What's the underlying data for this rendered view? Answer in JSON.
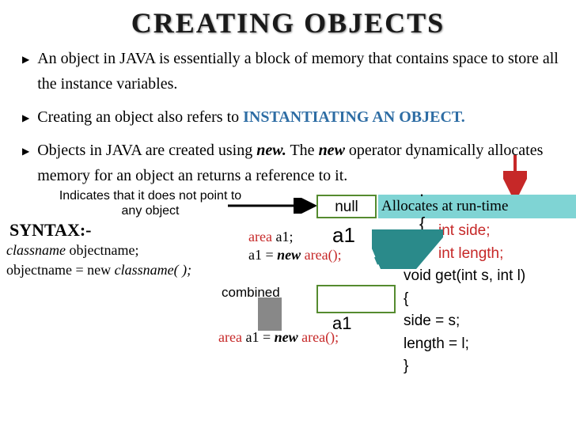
{
  "title": "CREATING OBJECTS",
  "bullets": [
    {
      "pre": "An object in JAVA is essentially a block of memory that contains space to store all the instance variables."
    },
    {
      "pre": "Creating an object also refers to ",
      "blue": "INSTANTIATING AN OBJECT."
    },
    {
      "pre": "Objects in JAVA are created using ",
      "ital": "new.",
      "post": " The ",
      "ital2": "new",
      "post2": " operator dynamically allocates memory for an object an returns a reference to it."
    }
  ],
  "indicateNote": "Indicates that it does not point to any object",
  "nullBox": "null",
  "allocStrip": "Allocates at run-time",
  "syntax": {
    "label": "SYNTAX:-",
    "line1a": "classname",
    "line1b": "   objectname;",
    "line2a": "objectname  =  new  ",
    "line2b": "classname( );"
  },
  "a1Labels": {
    "one": "a1",
    "two": "a1"
  },
  "codeArea1": {
    "l1a": "area",
    "l1b": " a1;",
    "l2a": "a1 = ",
    "l2b": "new ",
    "l2c": "area();"
  },
  "combined": "combined",
  "codeArea2": {
    "a": "area",
    "b": " a1 = ",
    "c": "new ",
    "d": "area();"
  },
  "codeBlock": {
    "l1": "int side;",
    "l2": "int length;",
    "l3": "void get(int s, int l)",
    "l4": "   {",
    "l5": "      side = s;",
    "l6": "      length =  l;",
    "l7": "   }"
  },
  "braceTop": ".",
  "braceMid": "{"
}
